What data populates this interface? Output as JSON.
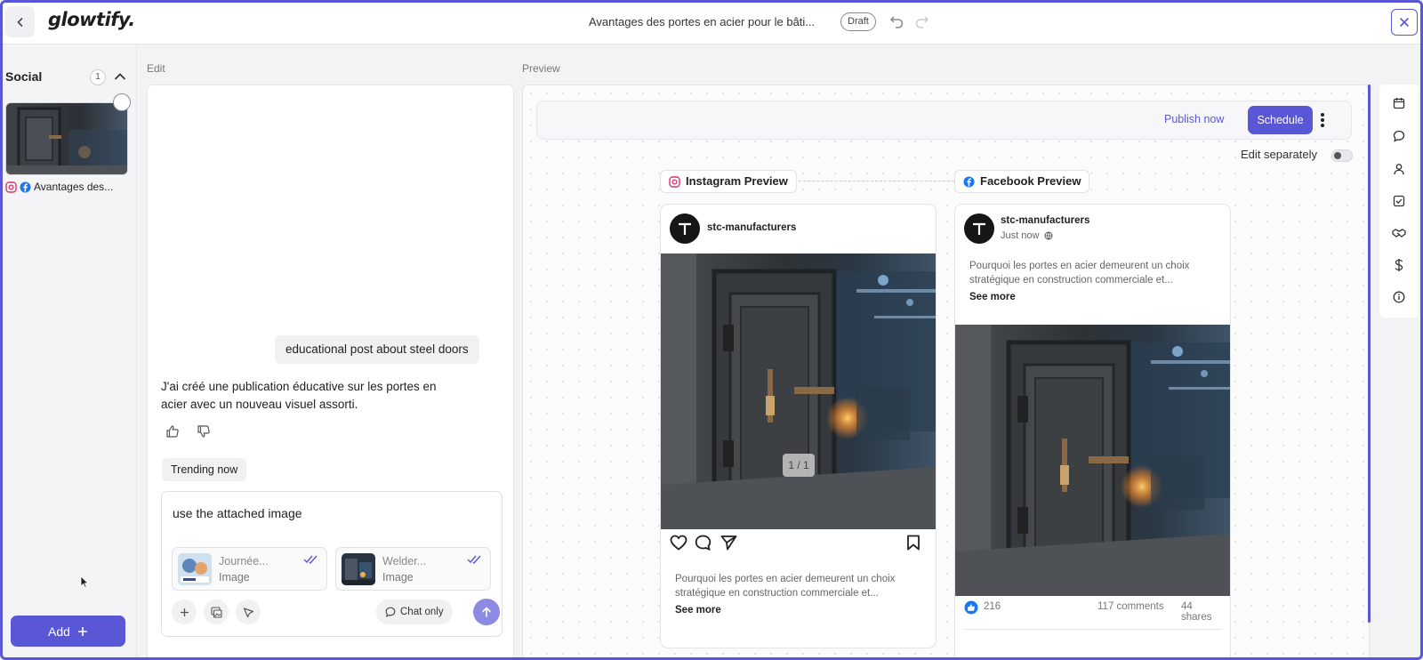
{
  "app": {
    "logo": "glowtify.",
    "document_title": "Avantages des portes en acier pour le bâti...",
    "status": "Draft"
  },
  "sidebar": {
    "section_title": "Social",
    "section_count": "1",
    "posts": [
      {
        "title": "Avantages des...",
        "platforms": [
          "instagram",
          "facebook"
        ]
      }
    ],
    "add_label": "Add"
  },
  "edit": {
    "label": "Edit",
    "messages": [
      {
        "role": "user",
        "text": "educational post about steel doors"
      },
      {
        "role": "assistant",
        "text": "J'ai créé une publication éducative sur les portes en acier avec un nouveau visuel assorti."
      }
    ],
    "suggestion_chip": "Trending now",
    "composer": {
      "text": "use the attached image",
      "attachments": [
        {
          "name": "Journée...",
          "type": "Image"
        },
        {
          "name": "Welder...",
          "type": "Image"
        }
      ],
      "chat_only_label": "Chat only"
    }
  },
  "preview": {
    "label": "Preview",
    "publish_now_label": "Publish now",
    "schedule_label": "Schedule",
    "edit_separately_label": "Edit separately",
    "edit_separately_on": false,
    "instagram": {
      "tab_label": "Instagram Preview",
      "account": "stc-manufacturers",
      "pager": "1 / 1",
      "caption": "Pourquoi les portes en acier demeurent un choix stratégique en construction commerciale et...",
      "see_more": "See more"
    },
    "facebook": {
      "tab_label": "Facebook Preview",
      "account": "stc-manufacturers",
      "timestamp": "Just now",
      "caption": "Pourquoi les portes en acier demeurent un choix stratégique en construction commerciale et...",
      "see_more": "See more",
      "reactions": "216",
      "comments": "117 comments",
      "shares": "44 shares"
    }
  },
  "right_rail": {
    "icons": [
      "calendar-icon",
      "chat-icon",
      "user-icon",
      "checklist-icon",
      "handshake-icon",
      "dollar-icon",
      "info-icon"
    ]
  },
  "colors": {
    "accent": "#5a57d6",
    "send_button": "#8d8ae3",
    "instagram": "#e1306c",
    "facebook": "#1877f2"
  }
}
